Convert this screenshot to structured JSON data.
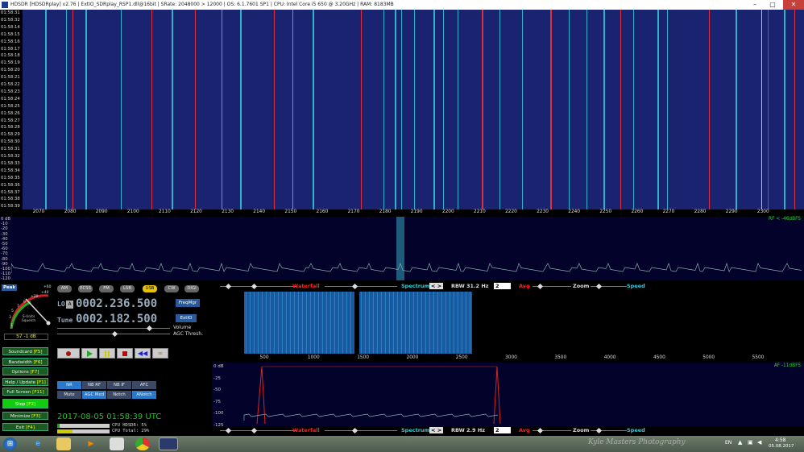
{
  "title": "HDSDR [HDSDRplay]  v2.76  |  ExtIO_SDRplay_RSP1.dll@16bit  |  SRate: 2048000 > 12000  |  OS: 6.1.7601 SP1  |  CPU: Intel Core i5        650  @ 3.20GHz  |  RAM: 8183MB",
  "window_buttons": {
    "minimize": "–",
    "maximize": "▢",
    "close": "✕"
  },
  "waterfall_times": [
    "01:58:31",
    "01:58:32",
    "01:58:14",
    "01:58:15",
    "01:58:16",
    "01:58:17",
    "01:58:18",
    "01:58:19",
    "01:58:20",
    "01:58:21",
    "01:58:22",
    "01:58:23",
    "01:58:24",
    "01:58:25",
    "01:58:26",
    "01:58:27",
    "01:58:28",
    "01:58:29",
    "01:58:30",
    "01:58:31",
    "01:58:32",
    "01:58:33",
    "01:58:34",
    "01:58:35",
    "01:58:36",
    "01:58:37",
    "01:58:38",
    "01:58:39"
  ],
  "freq_axis": [
    "2070",
    "2080",
    "2090",
    "2100",
    "2110",
    "2120",
    "2130",
    "2140",
    "2150",
    "2160",
    "2170",
    "2180",
    "2190",
    "2200",
    "2210",
    "2220",
    "2230",
    "2240",
    "2250",
    "2260",
    "2270",
    "2280",
    "2290",
    "2300"
  ],
  "rf_spectrum": {
    "y_labels": [
      "0 dB",
      "-10",
      "-20",
      "-30",
      "-40",
      "-50",
      "-60",
      "-70",
      "-80",
      "-90",
      "-100",
      "-110",
      "-120"
    ],
    "level_text": "RF < -46dBFS"
  },
  "controls_top": {
    "waterfall": "Waterfall",
    "spectrum": "Spectrum",
    "rbw": "RBW  31.2 Hz",
    "rbw_sel": "2",
    "avg": "Avg",
    "zoom": "Zoom",
    "speed": "Speed",
    "spin": "< >"
  },
  "controls_bottom": {
    "waterfall": "Waterfall",
    "spectrum": "Spectrum",
    "rbw": "RBW  2.9 Hz",
    "rbw_sel": "2",
    "avg": "Avg",
    "zoom": "Zoom",
    "speed": "Speed",
    "spin": "< >"
  },
  "smeter": {
    "peak": "Peak",
    "reading": "S7 -1 dB",
    "units": "S-Units\nSquelch",
    "scale": [
      "1",
      "3",
      "5",
      "7",
      "9",
      "+20",
      "+40"
    ],
    "peak_value": "+60"
  },
  "modes": [
    "AM",
    "ECSS",
    "FM",
    "LSB",
    "USB",
    "CW",
    "DIGI"
  ],
  "active_mode": "USB",
  "lo": {
    "label": "LO",
    "btn": "A",
    "value": "0002.236.500"
  },
  "tune": {
    "label": "Tune",
    "value": "0002.182.500"
  },
  "buttons": {
    "freqmgr": "FreqMgr",
    "extio": "ExtIO",
    "volume": "Volume",
    "agc": "AGC Thresh."
  },
  "menu": [
    {
      "label": "Soundcard",
      "key": "[F5]"
    },
    {
      "label": "Bandwidth",
      "key": "[F6]"
    },
    {
      "label": "Options",
      "key": "[F7]"
    },
    {
      "label": "Help / Update",
      "key": "[F1]"
    },
    {
      "label": "Full Screen",
      "key": "[F11]"
    },
    {
      "label": "Stop",
      "key": "[F2]"
    },
    {
      "label": "Minimize",
      "key": "[F3]"
    },
    {
      "label": "Exit",
      "key": "[F4]"
    }
  ],
  "nr_buttons": [
    "NR",
    "NB RF",
    "NB IF",
    "AFC"
  ],
  "nr_buttons2": [
    "Mute",
    "AGC Med",
    "Notch",
    "ANotch"
  ],
  "datetime": "2017-08-05  01:58:39 UTC",
  "cpu": {
    "hdsdr": "CPU HDSDR:  5%",
    "total": "CPU Total: 29%"
  },
  "af_axis": [
    "500",
    "1000",
    "1500",
    "2000",
    "2500",
    "3000",
    "3500",
    "4000",
    "4500",
    "5000",
    "5500"
  ],
  "af_spectrum": {
    "y_labels": [
      "0 dB",
      "-25",
      "-50",
      "-75",
      "-100",
      "-125"
    ],
    "level_text": "AF -11dBFS"
  },
  "taskbar": {
    "lang": "EN",
    "time": "4:58",
    "date": "05.08.2017",
    "watermark": "Kyle Masters Photography"
  },
  "colors": {
    "accent_cyan": "#33ccdd",
    "waterfall_red": "#ff2222",
    "stop_btn": "#11cc11",
    "waterfall_bg": "#1a2370"
  }
}
